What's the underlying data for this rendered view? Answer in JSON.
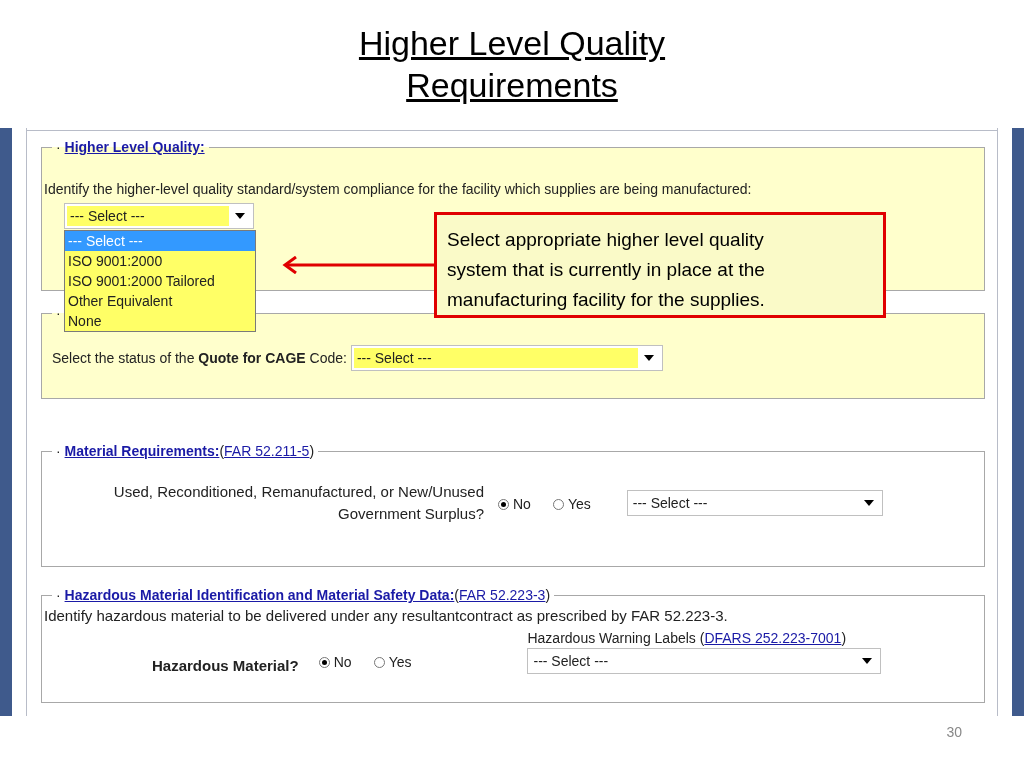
{
  "slide": {
    "title": "Higher Level Quality Requirements",
    "page_number": "30"
  },
  "sections": [
    {
      "kind": "quality",
      "legend": {
        "bullet": "·",
        "link": "Higher Level Quality:"
      },
      "prompt": "Identify the higher-level quality standard/system compliance for the facility which supplies are being manufactured:",
      "select": {
        "value": "--- Select ---",
        "highlighted": true,
        "options": [
          {
            "label": "--- Select ---",
            "selected": true
          },
          {
            "label": "ISO 9001:2000",
            "selected": false
          },
          {
            "label": "ISO 9001:2000 Tailored",
            "selected": false
          },
          {
            "label": "Other Equivalent",
            "selected": false
          },
          {
            "label": "None",
            "selected": false
          }
        ]
      }
    },
    {
      "kind": "cage",
      "legend": {
        "bullet": "·"
      },
      "prompt": "Select the status of the **Quote for CAGE** Code:",
      "select": {
        "value": "--- Select ---",
        "highlighted": true
      }
    },
    {
      "kind": "material",
      "legend": {
        "bullet": "·",
        "link": "Material Requirements:",
        "open": "(",
        "reference": "FAR 52.211-5",
        "close": ")"
      },
      "question": "Used, Reconditioned, Remanufactured, or New/Unused Government Surplus?",
      "radios": [
        {
          "label": "No",
          "selected": true
        },
        {
          "label": "Yes",
          "selected": false
        }
      ],
      "select": {
        "value": "--- Select ---",
        "highlighted": false
      }
    },
    {
      "kind": "hazardous",
      "legend": {
        "bullet": "·",
        "link": "Hazardous Material Identification and Material Safety Data:",
        "open": "(",
        "reference": "FAR 52.223-3",
        "close": ")"
      },
      "note": "Identify hazardous material to be delivered under any resultantcontract as prescribed by FAR 52.223-3.",
      "question": "Hazardous Material?",
      "radios": [
        {
          "label": "No",
          "selected": true
        },
        {
          "label": "Yes",
          "selected": false
        }
      ],
      "labels": {
        "caption": "Hazardous Warning Labels",
        "open": "(",
        "reference": "DFARS 252.223-7001",
        "close": ")"
      },
      "select": {
        "value": "--- Select ---",
        "highlighted": false
      }
    }
  ],
  "callout": {
    "text": "Select appropriate higher level quality system that is currently in place at the manufacturing facility for the supplies."
  }
}
